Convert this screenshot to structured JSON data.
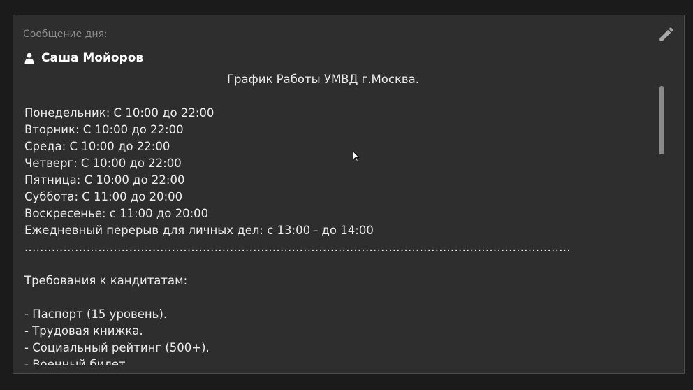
{
  "panel": {
    "label": "Сообщение дня:",
    "edit_icon": "pencil-icon"
  },
  "author": {
    "icon": "user-icon",
    "name": "Саша Мойоров"
  },
  "message": {
    "lines": [
      "График Работы УМВД г.Москва.",
      "",
      "Понедельник: С 10:00 до 22:00",
      "Вторник: С 10:00 до 22:00",
      "Среда: С 10:00 до 22:00",
      "Четверг: С 10:00 до 22:00",
      "Пятница: С 10:00 до 22:00",
      "Суббота: С 11:00 до 20:00",
      "Воскресенье: с 11:00 до 20:00",
      "Ежедневный перерыв для личных дел: с 13:00 - до 14:00",
      ".............................................................................................................................................",
      "",
      "Требования к кандитатам:",
      "",
      "- Паспорт (15 уровень).",
      "- Трудовая книжка.",
      "- Социальный рейтинг (500+).",
      "- Военный билет."
    ]
  },
  "colors": {
    "background": "#1b1b1b",
    "panel": "#2e2e2e",
    "text": "#ececec",
    "label": "#8c8c8c"
  }
}
